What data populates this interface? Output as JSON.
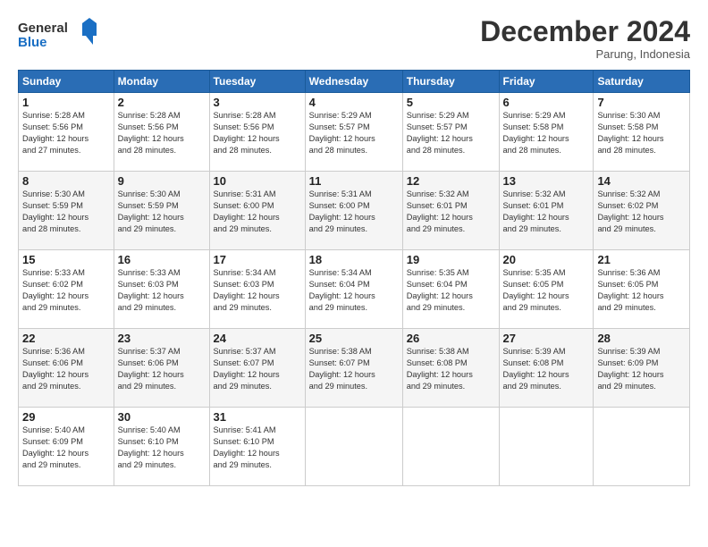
{
  "logo": {
    "text_general": "General",
    "text_blue": "Blue"
  },
  "header": {
    "month": "December 2024",
    "location": "Parung, Indonesia"
  },
  "days_of_week": [
    "Sunday",
    "Monday",
    "Tuesday",
    "Wednesday",
    "Thursday",
    "Friday",
    "Saturday"
  ],
  "weeks": [
    [
      {
        "day": "1",
        "info": "Sunrise: 5:28 AM\nSunset: 5:56 PM\nDaylight: 12 hours\nand 27 minutes."
      },
      {
        "day": "2",
        "info": "Sunrise: 5:28 AM\nSunset: 5:56 PM\nDaylight: 12 hours\nand 28 minutes."
      },
      {
        "day": "3",
        "info": "Sunrise: 5:28 AM\nSunset: 5:56 PM\nDaylight: 12 hours\nand 28 minutes."
      },
      {
        "day": "4",
        "info": "Sunrise: 5:29 AM\nSunset: 5:57 PM\nDaylight: 12 hours\nand 28 minutes."
      },
      {
        "day": "5",
        "info": "Sunrise: 5:29 AM\nSunset: 5:57 PM\nDaylight: 12 hours\nand 28 minutes."
      },
      {
        "day": "6",
        "info": "Sunrise: 5:29 AM\nSunset: 5:58 PM\nDaylight: 12 hours\nand 28 minutes."
      },
      {
        "day": "7",
        "info": "Sunrise: 5:30 AM\nSunset: 5:58 PM\nDaylight: 12 hours\nand 28 minutes."
      }
    ],
    [
      {
        "day": "8",
        "info": "Sunrise: 5:30 AM\nSunset: 5:59 PM\nDaylight: 12 hours\nand 28 minutes."
      },
      {
        "day": "9",
        "info": "Sunrise: 5:30 AM\nSunset: 5:59 PM\nDaylight: 12 hours\nand 29 minutes."
      },
      {
        "day": "10",
        "info": "Sunrise: 5:31 AM\nSunset: 6:00 PM\nDaylight: 12 hours\nand 29 minutes."
      },
      {
        "day": "11",
        "info": "Sunrise: 5:31 AM\nSunset: 6:00 PM\nDaylight: 12 hours\nand 29 minutes."
      },
      {
        "day": "12",
        "info": "Sunrise: 5:32 AM\nSunset: 6:01 PM\nDaylight: 12 hours\nand 29 minutes."
      },
      {
        "day": "13",
        "info": "Sunrise: 5:32 AM\nSunset: 6:01 PM\nDaylight: 12 hours\nand 29 minutes."
      },
      {
        "day": "14",
        "info": "Sunrise: 5:32 AM\nSunset: 6:02 PM\nDaylight: 12 hours\nand 29 minutes."
      }
    ],
    [
      {
        "day": "15",
        "info": "Sunrise: 5:33 AM\nSunset: 6:02 PM\nDaylight: 12 hours\nand 29 minutes."
      },
      {
        "day": "16",
        "info": "Sunrise: 5:33 AM\nSunset: 6:03 PM\nDaylight: 12 hours\nand 29 minutes."
      },
      {
        "day": "17",
        "info": "Sunrise: 5:34 AM\nSunset: 6:03 PM\nDaylight: 12 hours\nand 29 minutes."
      },
      {
        "day": "18",
        "info": "Sunrise: 5:34 AM\nSunset: 6:04 PM\nDaylight: 12 hours\nand 29 minutes."
      },
      {
        "day": "19",
        "info": "Sunrise: 5:35 AM\nSunset: 6:04 PM\nDaylight: 12 hours\nand 29 minutes."
      },
      {
        "day": "20",
        "info": "Sunrise: 5:35 AM\nSunset: 6:05 PM\nDaylight: 12 hours\nand 29 minutes."
      },
      {
        "day": "21",
        "info": "Sunrise: 5:36 AM\nSunset: 6:05 PM\nDaylight: 12 hours\nand 29 minutes."
      }
    ],
    [
      {
        "day": "22",
        "info": "Sunrise: 5:36 AM\nSunset: 6:06 PM\nDaylight: 12 hours\nand 29 minutes."
      },
      {
        "day": "23",
        "info": "Sunrise: 5:37 AM\nSunset: 6:06 PM\nDaylight: 12 hours\nand 29 minutes."
      },
      {
        "day": "24",
        "info": "Sunrise: 5:37 AM\nSunset: 6:07 PM\nDaylight: 12 hours\nand 29 minutes."
      },
      {
        "day": "25",
        "info": "Sunrise: 5:38 AM\nSunset: 6:07 PM\nDaylight: 12 hours\nand 29 minutes."
      },
      {
        "day": "26",
        "info": "Sunrise: 5:38 AM\nSunset: 6:08 PM\nDaylight: 12 hours\nand 29 minutes."
      },
      {
        "day": "27",
        "info": "Sunrise: 5:39 AM\nSunset: 6:08 PM\nDaylight: 12 hours\nand 29 minutes."
      },
      {
        "day": "28",
        "info": "Sunrise: 5:39 AM\nSunset: 6:09 PM\nDaylight: 12 hours\nand 29 minutes."
      }
    ],
    [
      {
        "day": "29",
        "info": "Sunrise: 5:40 AM\nSunset: 6:09 PM\nDaylight: 12 hours\nand 29 minutes."
      },
      {
        "day": "30",
        "info": "Sunrise: 5:40 AM\nSunset: 6:10 PM\nDaylight: 12 hours\nand 29 minutes."
      },
      {
        "day": "31",
        "info": "Sunrise: 5:41 AM\nSunset: 6:10 PM\nDaylight: 12 hours\nand 29 minutes."
      },
      {
        "day": "",
        "info": ""
      },
      {
        "day": "",
        "info": ""
      },
      {
        "day": "",
        "info": ""
      },
      {
        "day": "",
        "info": ""
      }
    ]
  ]
}
